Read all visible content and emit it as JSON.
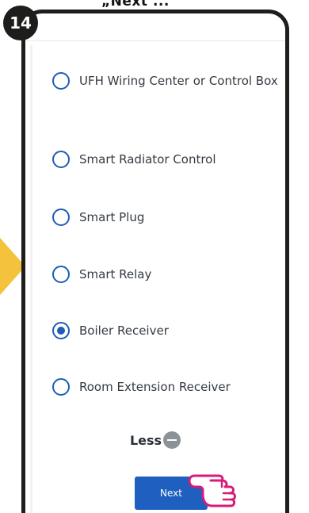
{
  "caption": {
    "text": "„Next ...",
    "step_number": "14"
  },
  "options": [
    {
      "label": "UFH Wiring Center or Control Box",
      "selected": false
    },
    {
      "label": "Smart Radiator Control",
      "selected": false
    },
    {
      "label": "Smart Plug",
      "selected": false
    },
    {
      "label": "Smart Relay",
      "selected": false
    },
    {
      "label": "Boiler Receiver",
      "selected": true
    },
    {
      "label": "Room Extension Receiver",
      "selected": false
    }
  ],
  "less": {
    "label": "Less"
  },
  "next_button": {
    "label": "Next"
  },
  "icons": {
    "pointer": "hand-pointer-icon",
    "arrow": "arrow-right-icon",
    "less": "minus-circle-icon"
  },
  "colors": {
    "accent": "#1f5fbf",
    "radio": "#1e5cb8",
    "badge": "#1d1d1b",
    "arrow": "#f4c23c",
    "hand_outline": "#d81b7a"
  }
}
